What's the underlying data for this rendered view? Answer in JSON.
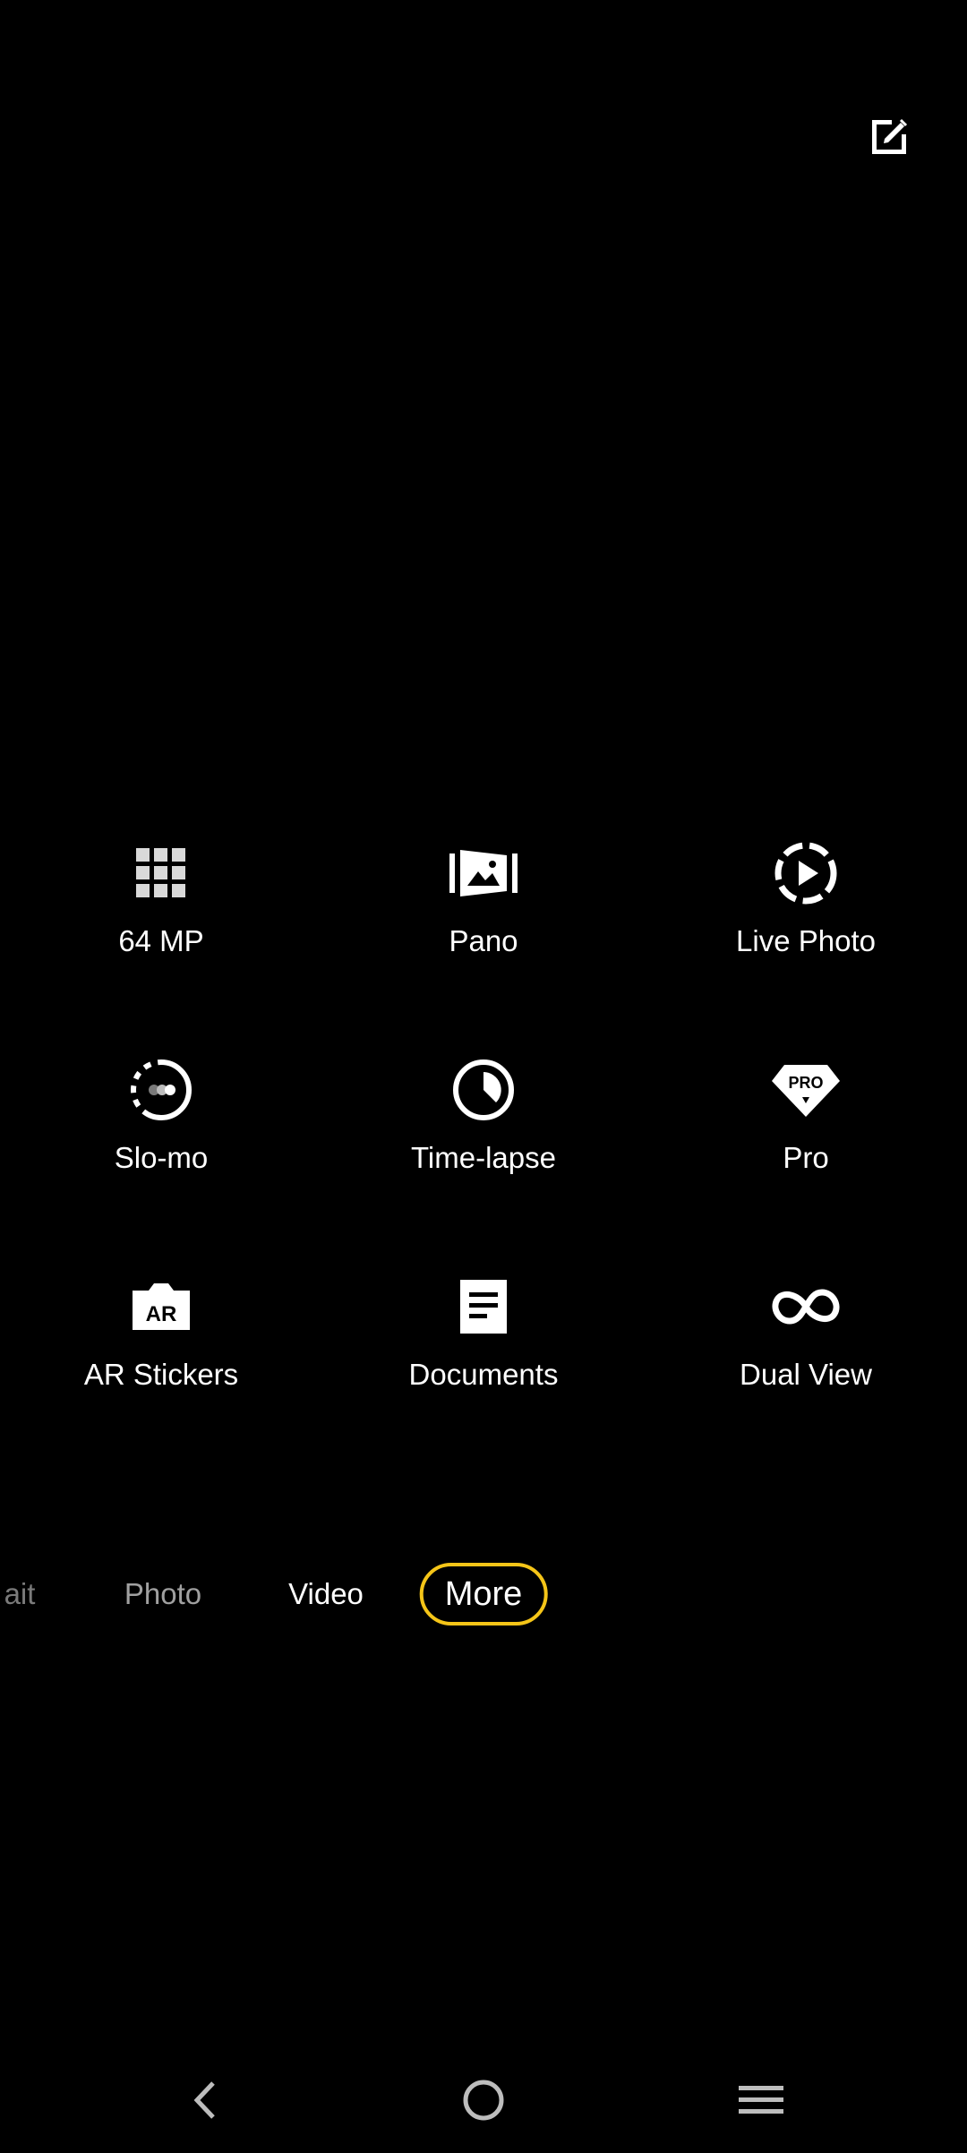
{
  "toolbar": {
    "edit_icon": "edit-square-icon"
  },
  "modes": [
    {
      "label": "64 MP",
      "icon": "grid-icon"
    },
    {
      "label": "Pano",
      "icon": "panorama-icon"
    },
    {
      "label": "Live Photo",
      "icon": "live-photo-icon"
    },
    {
      "label": "Slo-mo",
      "icon": "slow-motion-icon"
    },
    {
      "label": "Time-lapse",
      "icon": "clock-icon"
    },
    {
      "label": "Pro",
      "icon": "pro-badge-icon"
    },
    {
      "label": "AR Stickers",
      "icon": "ar-icon"
    },
    {
      "label": "Documents",
      "icon": "document-icon"
    },
    {
      "label": "Dual View",
      "icon": "infinity-icon"
    }
  ],
  "mode_bar": {
    "portrait_partial": "ait",
    "photo": "Photo",
    "video": "Video",
    "more": "More"
  },
  "pro_icon_text": "PRO",
  "ar_icon_text": "AR",
  "colors": {
    "background": "#000000",
    "accent": "#f5c518",
    "text": "#ffffff"
  },
  "nav": {
    "back_icon": "back-chevron-icon",
    "home_icon": "home-circle-icon",
    "menu_icon": "menu-lines-icon"
  }
}
